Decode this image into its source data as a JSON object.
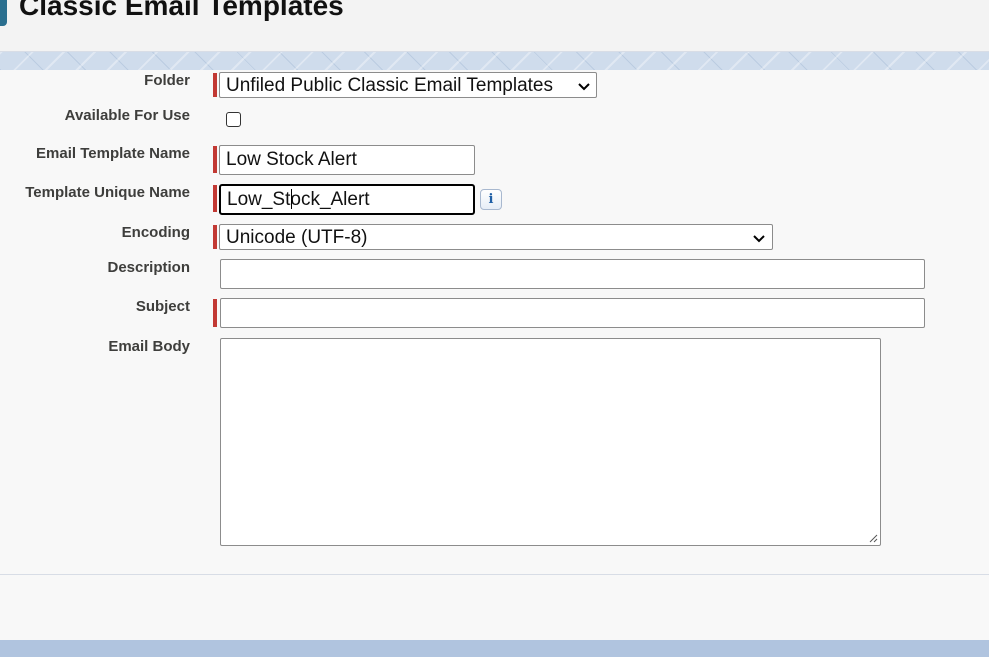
{
  "header": {
    "title": "Classic Email Templates"
  },
  "form": {
    "folder": {
      "label": "Folder",
      "value": "Unfiled Public Classic Email Templates",
      "required": true
    },
    "available": {
      "label": "Available For Use",
      "checked": false
    },
    "template_name": {
      "label": "Email Template Name",
      "value": "Low Stock Alert",
      "required": true
    },
    "unique_name": {
      "label": "Template Unique Name",
      "value": "Low_Stock_Alert",
      "required": true,
      "info_glyph": "i"
    },
    "encoding": {
      "label": "Encoding",
      "value": "Unicode (UTF-8)",
      "required": true
    },
    "description": {
      "label": "Description",
      "value": ""
    },
    "subject": {
      "label": "Subject",
      "value": "",
      "required": true
    },
    "body": {
      "label": "Email Body",
      "value": ""
    }
  },
  "colors": {
    "required_marker": "#c23934",
    "footer_band": "#b0c4df",
    "header_pattern": "#cfdcec"
  },
  "icons": {
    "info": "info-icon",
    "dropdown": "chevron-down-icon",
    "resize": "resize-grip-icon"
  }
}
